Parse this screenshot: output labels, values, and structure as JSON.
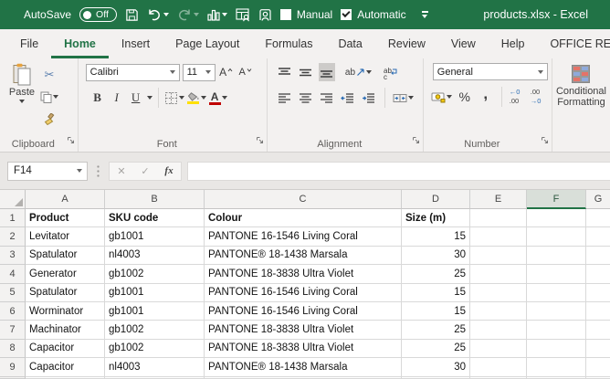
{
  "titlebar": {
    "autosave_label": "AutoSave",
    "autosave_state": "Off",
    "manual_label": "Manual",
    "automatic_label": "Automatic",
    "doc_title": "products.xlsx  -  Excel"
  },
  "tabs": [
    {
      "label": "File",
      "active": false
    },
    {
      "label": "Home",
      "active": true
    },
    {
      "label": "Insert",
      "active": false
    },
    {
      "label": "Page Layout",
      "active": false
    },
    {
      "label": "Formulas",
      "active": false
    },
    {
      "label": "Data",
      "active": false
    },
    {
      "label": "Review",
      "active": false
    },
    {
      "label": "View",
      "active": false
    },
    {
      "label": "Help",
      "active": false
    },
    {
      "label": "OFFICE REMOTE",
      "active": false
    }
  ],
  "ribbon": {
    "clipboard": {
      "paste": "Paste",
      "label": "Clipboard"
    },
    "font": {
      "name": "Calibri",
      "size": "11",
      "grow": "A",
      "shrink": "A",
      "bold": "B",
      "italic": "I",
      "underline": "U",
      "color_letter": "A",
      "fill_color": "#ffe000",
      "font_color": "#c00000",
      "label": "Font"
    },
    "alignment": {
      "orientation_text": "ab",
      "wrap_text": "ab",
      "label": "Alignment"
    },
    "number": {
      "format": "General",
      "percent": "%",
      "comma": ",",
      "inc_top": "←0",
      "inc_bottom": ".00",
      "dec_top": ".00",
      "dec_bottom": "→0",
      "label": "Number"
    },
    "styles": {
      "line1": "Conditional",
      "line2": "Formatting"
    }
  },
  "formula_bar": {
    "name_box": "F14",
    "cancel": "✕",
    "enter": "✓",
    "fx": "fx"
  },
  "grid": {
    "col_headers": [
      "A",
      "B",
      "C",
      "D",
      "E",
      "F",
      "G"
    ],
    "active_col": "F",
    "header_row": {
      "num": "1",
      "product": "Product",
      "sku": "SKU code",
      "colour": "Colour",
      "size": "Size (m)"
    },
    "rows": [
      {
        "num": "2",
        "product": "Levitator",
        "sku": "gb1001",
        "colour": "PANTONE 16-1546 Living Coral",
        "size": "15"
      },
      {
        "num": "3",
        "product": "Spatulator",
        "sku": "nl4003",
        "colour": "PANTONE® 18-1438 Marsala",
        "size": "30"
      },
      {
        "num": "4",
        "product": "Generator",
        "sku": "gb1002",
        "colour": "PANTONE 18-3838 Ultra Violet",
        "size": "25"
      },
      {
        "num": "5",
        "product": "Spatulator",
        "sku": "gb1001",
        "colour": "PANTONE 16-1546 Living Coral",
        "size": "15"
      },
      {
        "num": "6",
        "product": "Worminator",
        "sku": "gb1001",
        "colour": "PANTONE 16-1546 Living Coral",
        "size": "15"
      },
      {
        "num": "7",
        "product": "Machinator",
        "sku": "gb1002",
        "colour": "PANTONE 18-3838 Ultra Violet",
        "size": "25"
      },
      {
        "num": "8",
        "product": "Capacitor",
        "sku": "gb1002",
        "colour": "PANTONE 18-3838 Ultra Violet",
        "size": "25"
      },
      {
        "num": "9",
        "product": "Capacitor",
        "sku": "nl4003",
        "colour": "PANTONE® 18-1438 Marsala",
        "size": "30"
      }
    ],
    "theme": {
      "accent_green": "#217346",
      "gridline": "#d9d9d9"
    }
  }
}
